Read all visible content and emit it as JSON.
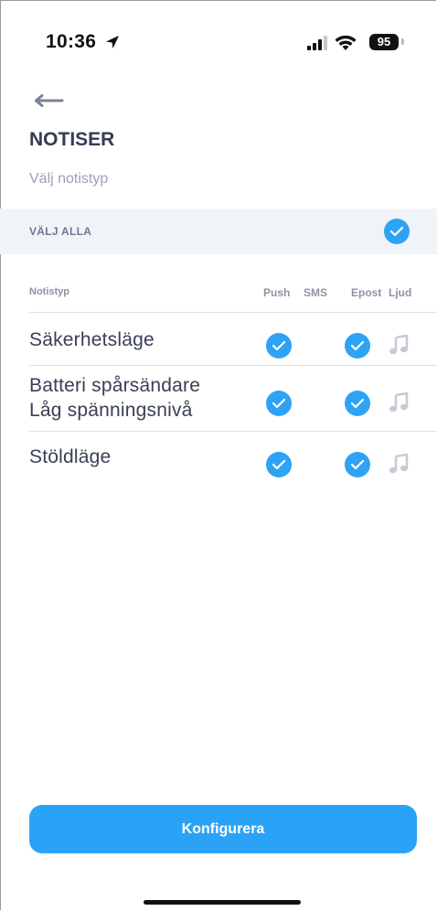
{
  "status_bar": {
    "time": "10:36",
    "battery": "95"
  },
  "page": {
    "title": "NOTISER",
    "subtitle": "Välj notistyp"
  },
  "select_all": {
    "label": "VÄLJ ALLA",
    "checked": true
  },
  "columns": {
    "type": "Notistyp",
    "push": "Push",
    "sms": "SMS",
    "epost": "Epost",
    "ljud": "Ljud"
  },
  "rows": [
    {
      "label_line1": "Säkerhetsläge",
      "label_line2": "",
      "push": true,
      "sms": false,
      "epost": true,
      "ljud_icon": "music-note-icon"
    },
    {
      "label_line1": "Batteri spårsändare",
      "label_line2": "Låg spänningsnivå",
      "push": true,
      "sms": false,
      "epost": true,
      "ljud_icon": "music-note-icon"
    },
    {
      "label_line1": "Stöldläge",
      "label_line2": "",
      "push": true,
      "sms": false,
      "epost": true,
      "ljud_icon": "music-note-icon"
    }
  ],
  "cta": {
    "label": "Konfigurera"
  },
  "colors": {
    "accent": "#2ea3f5",
    "icon_gray": "#c5cbd6",
    "background": "#ffffff"
  }
}
